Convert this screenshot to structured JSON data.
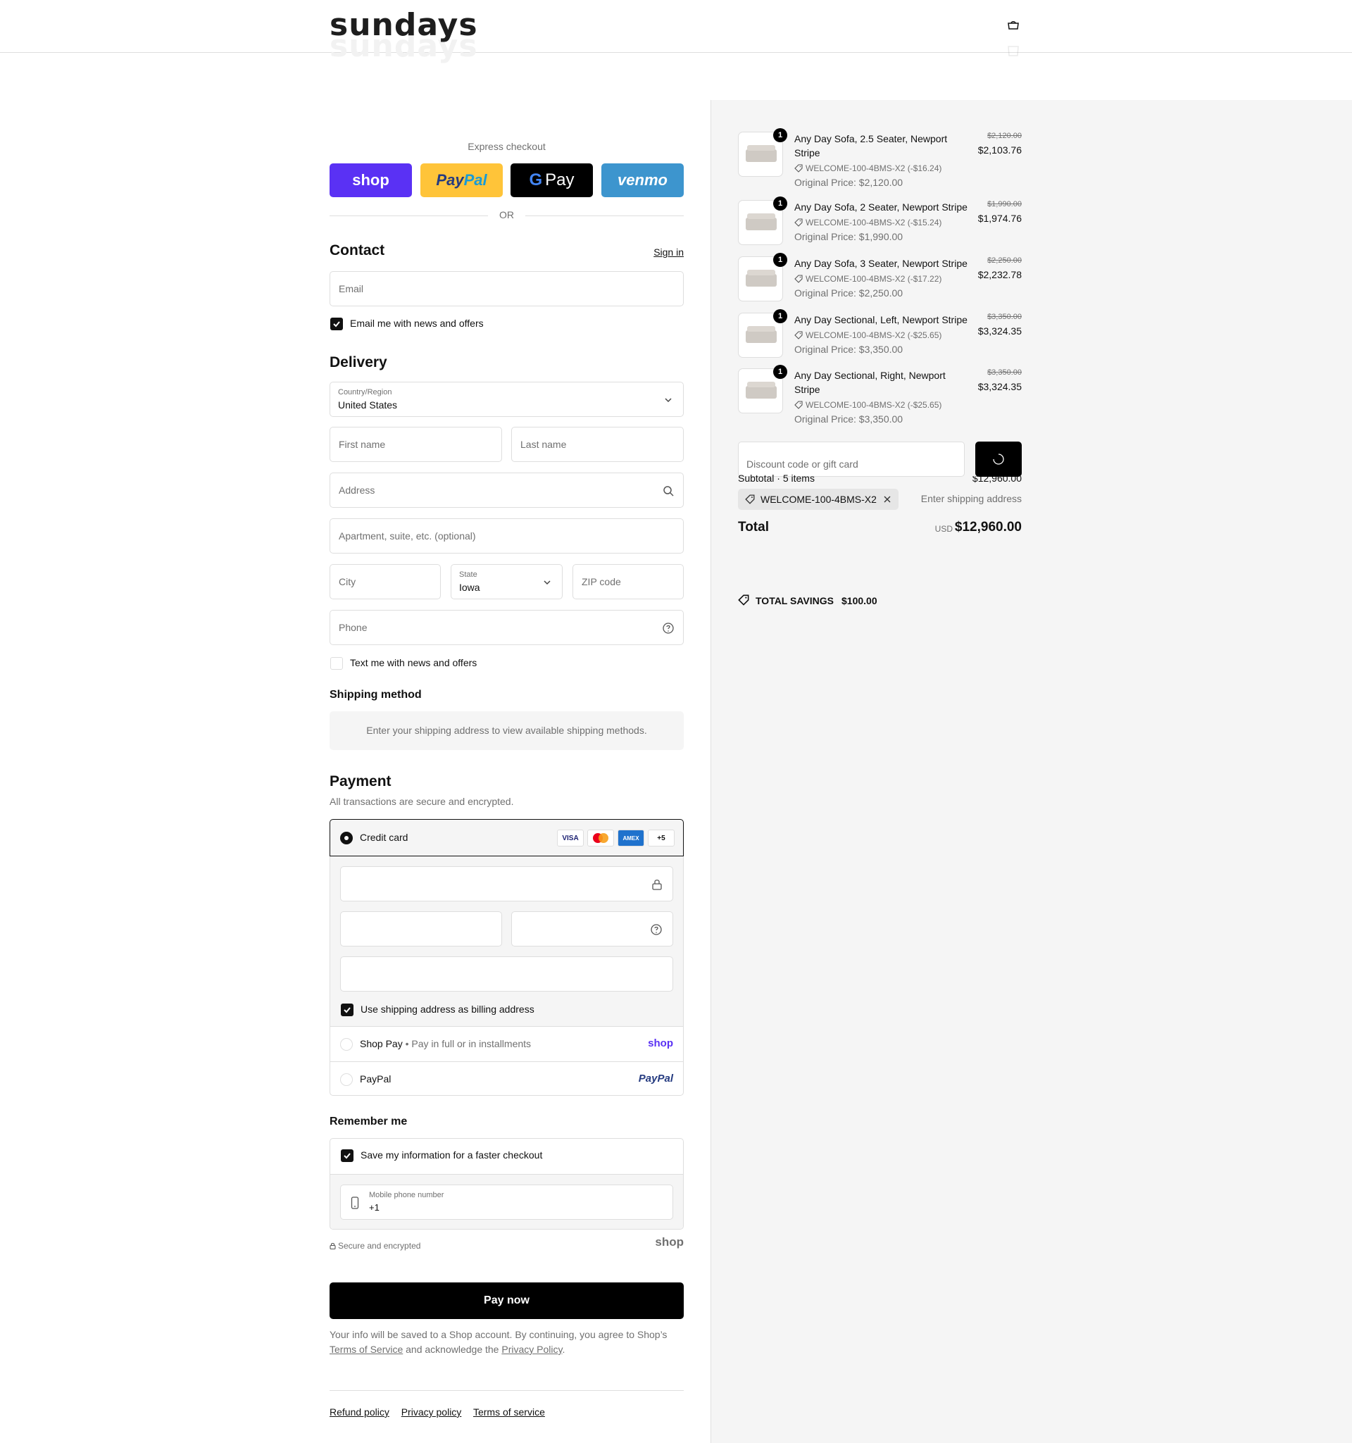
{
  "header": {
    "logo": "sundays",
    "cart_icon": "shopping-bag-icon"
  },
  "express": {
    "title": "Express checkout",
    "buttons": {
      "shop": "shop",
      "paypal_a": "Pay",
      "paypal_b": "Pal",
      "gpay": "Pay",
      "venmo": "venmo"
    },
    "or": "OR"
  },
  "contact": {
    "title": "Contact",
    "sign_in": "Sign in",
    "email_placeholder": "Email",
    "news_label": "Email me with news and offers"
  },
  "delivery": {
    "title": "Delivery",
    "country_label": "Country/Region",
    "country_value": "United States",
    "first_name": "First name",
    "last_name": "Last name",
    "address": "Address",
    "apartment": "Apartment, suite, etc. (optional)",
    "city": "City",
    "state_label": "State",
    "state_value": "Iowa",
    "zip": "ZIP code",
    "phone": "Phone",
    "text_label": "Text me with news and offers"
  },
  "shipping": {
    "title": "Shipping method",
    "note": "Enter your shipping address to view available shipping methods."
  },
  "payment": {
    "title": "Payment",
    "subtitle": "All transactions are secure and encrypted.",
    "credit_card": "Credit card",
    "cards": [
      "VISA",
      "MC",
      "AMEX",
      "+5"
    ],
    "billing_label": "Use shipping address as billing address",
    "shop_pay": "Shop Pay",
    "shop_pay_sub": "Pay in full or in installments",
    "shop_brand": "shop",
    "paypal": "PayPal",
    "paypal_brand": "PayPal"
  },
  "remember": {
    "title": "Remember me",
    "save_label": "Save my information for a faster checkout",
    "mobile_label": "Mobile phone number",
    "mobile_value": "+1",
    "secure": "Secure and encrypted",
    "shop_brand": "shop"
  },
  "pay_now": "Pay now",
  "legal": {
    "line1": "Your info will be saved to a Shop account. By continuing, you agree to Shop’s",
    "tos": "Terms of Service",
    "and": " and acknowledge the ",
    "privacy": "Privacy Policy",
    "end": "."
  },
  "footer": {
    "refund": "Refund policy",
    "privacy": "Privacy policy",
    "terms": "Terms of service"
  },
  "summary": {
    "items": [
      {
        "qty": "1",
        "name": "Any Day Sofa, 2.5 Seater, Newport Stripe",
        "code": "WELCOME-100-4BMS-X2 (-$16.24)",
        "original": "Original Price: $2,120.00",
        "strike": "$2,120.00",
        "price": "$2,103.76"
      },
      {
        "qty": "1",
        "name": "Any Day Sofa, 2 Seater, Newport Stripe",
        "code": "WELCOME-100-4BMS-X2 (-$15.24)",
        "original": "Original Price: $1,990.00",
        "strike": "$1,990.00",
        "price": "$1,974.76"
      },
      {
        "qty": "1",
        "name": "Any Day Sofa, 3 Seater, Newport Stripe",
        "code": "WELCOME-100-4BMS-X2 (-$17.22)",
        "original": "Original Price: $2,250.00",
        "strike": "$2,250.00",
        "price": "$2,232.78"
      },
      {
        "qty": "1",
        "name": "Any Day Sectional, Left, Newport Stripe",
        "code": "WELCOME-100-4BMS-X2 (-$25.65)",
        "original": "Original Price: $3,350.00",
        "strike": "$3,350.00",
        "price": "$3,324.35"
      },
      {
        "qty": "1",
        "name": "Any Day Sectional, Right, Newport Stripe",
        "code": "WELCOME-100-4BMS-X2 (-$25.65)",
        "original": "Original Price: $3,350.00",
        "strike": "$3,350.00",
        "price": "$3,324.35"
      }
    ],
    "discount_placeholder": "Discount code or gift card",
    "subtotal_label": "Subtotal · 5 items",
    "subtotal_value": "$12,960.00",
    "applied_code": "WELCOME-100-4BMS-X2",
    "shipping_label": "Enter shipping address",
    "total_label": "Total",
    "currency": "USD",
    "total_value": "$12,960.00",
    "savings_label": "TOTAL SAVINGS",
    "savings_value": "$100.00"
  }
}
